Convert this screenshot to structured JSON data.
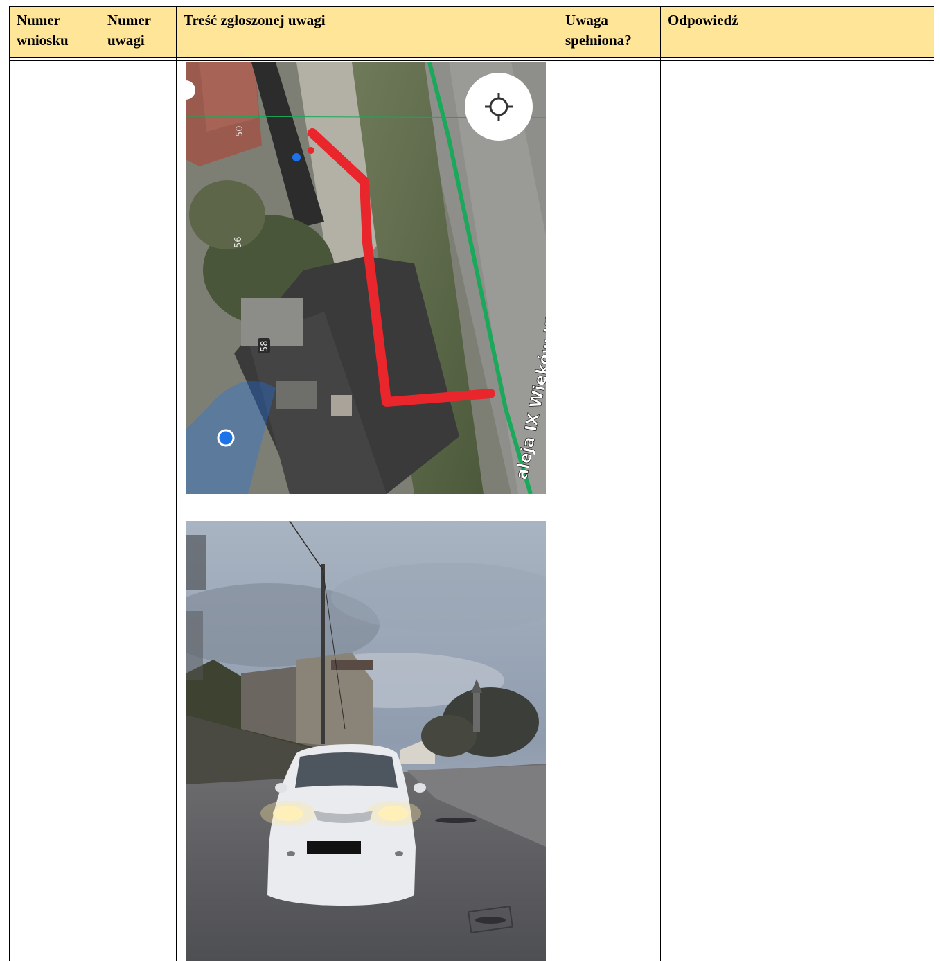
{
  "table": {
    "headers": {
      "request_no": [
        "Numer",
        "wniosku"
      ],
      "remark_no": [
        "Numer",
        "uwagi"
      ],
      "remark_content": "Treść zgłoszonej uwagi",
      "remark_accepted": [
        "Uwaga",
        "spełniona?"
      ],
      "response": "Odpowiedź"
    },
    "row": {
      "request_no": "",
      "remark_no": "",
      "remark_accepted": "",
      "response": ""
    }
  },
  "map_image": {
    "labels": {
      "street": "aleja IX Wieków Kielc",
      "house_50": "50",
      "house_56": "56",
      "house_58": "58"
    },
    "colors": {
      "route": "#e8262b",
      "road_line": "#1aa85a",
      "location_dot": "#1e73e8"
    },
    "icons": [
      "my-location-icon"
    ]
  },
  "photo_image": {
    "description_free": true
  }
}
